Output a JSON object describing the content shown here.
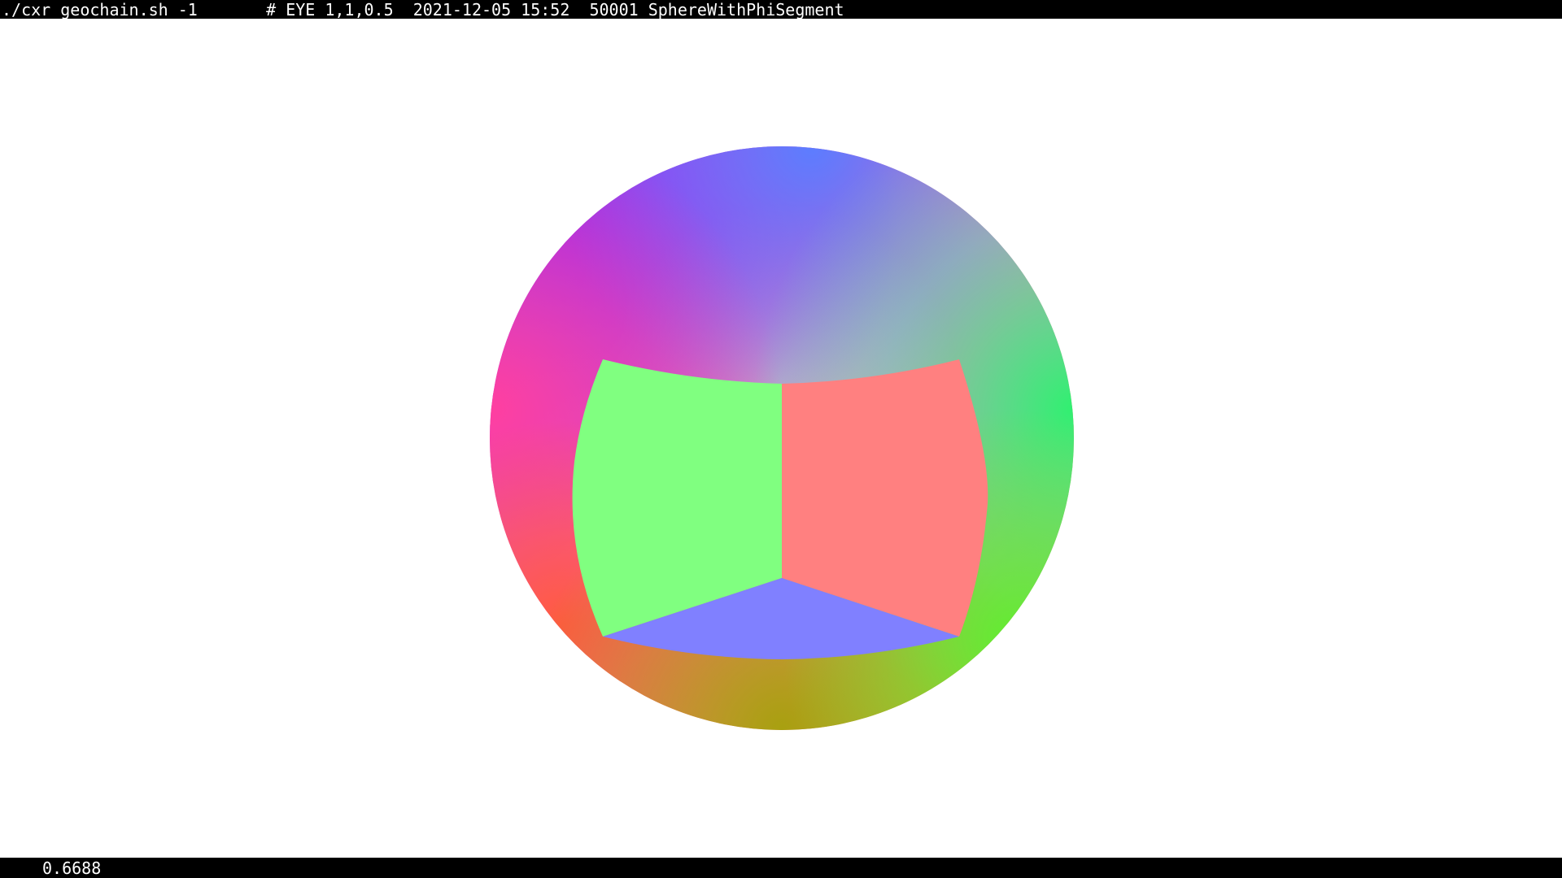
{
  "window": {
    "title_text": "./cxr_geochain.sh -1       # EYE 1,1,0.5  2021-12-05 15:52  50001 SphereWithPhiSegment"
  },
  "status": {
    "value_text": "0.6688"
  },
  "scene": {
    "background_color": "#ffffff",
    "bar_color": "#000000",
    "face_colors": {
      "green_face": "#80ff80",
      "red_face": "#ff8080",
      "blue_face": "#8080ff"
    }
  }
}
